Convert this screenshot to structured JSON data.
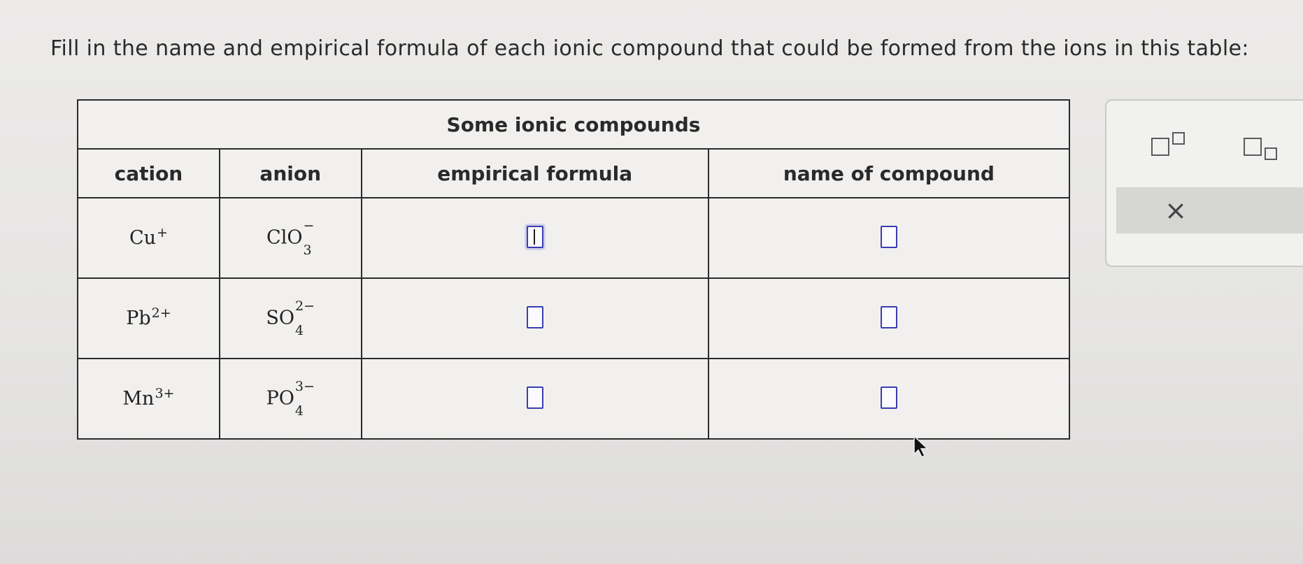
{
  "prompt": "Fill in the name and empirical formula of each ionic compound that could be formed from the ions in this table:",
  "table": {
    "title": "Some ionic compounds",
    "headers": {
      "cation": "cation",
      "anion": "anion",
      "formula": "empirical formula",
      "name": "name of compound"
    },
    "rows": [
      {
        "cation": {
          "base": "Cu",
          "charge": "+",
          "sub": ""
        },
        "anion": {
          "base": "ClO",
          "charge": "−",
          "sub": "3"
        }
      },
      {
        "cation": {
          "base": "Pb",
          "charge": "2+",
          "sub": ""
        },
        "anion": {
          "base": "SO",
          "charge": "2−",
          "sub": "4"
        }
      },
      {
        "cation": {
          "base": "Mn",
          "charge": "3+",
          "sub": ""
        },
        "anion": {
          "base": "PO",
          "charge": "3−",
          "sub": "4"
        }
      }
    ]
  },
  "palette": {
    "superscript_icon": "superscript-template-icon",
    "subscript_icon": "subscript-template-icon",
    "clear_label": "×"
  },
  "colors": {
    "answer_box": "#3a3db0"
  }
}
